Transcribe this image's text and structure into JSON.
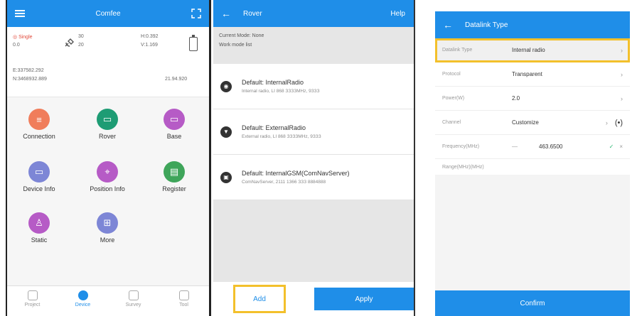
{
  "screen1": {
    "title": "Comfee",
    "status": {
      "solution": "Single",
      "line2": "0.0",
      "sat_a": "30",
      "sat_b": "20",
      "hrms": "H:0.392",
      "vrms": "V:1.169",
      "east": "E:337582.292",
      "north": "N:3468932.889",
      "alt": "21.94.920"
    },
    "tiles": [
      {
        "label": "Connection",
        "color": "#f07d5b",
        "icon": "connection-icon"
      },
      {
        "label": "Rover",
        "color": "#1e9c74",
        "icon": "rover-icon"
      },
      {
        "label": "Base",
        "color": "#b65bc6",
        "icon": "base-icon"
      },
      {
        "label": "Device Info",
        "color": "#7d86d6",
        "icon": "device-info-icon"
      },
      {
        "label": "Position Info",
        "color": "#b65bc6",
        "icon": "position-info-icon"
      },
      {
        "label": "Register",
        "color": "#3fa55a",
        "icon": "register-icon"
      },
      {
        "label": "Static",
        "color": "#b65bc6",
        "icon": "static-icon"
      },
      {
        "label": "More",
        "color": "#7d86d6",
        "icon": "more-icon"
      }
    ],
    "tabs": [
      {
        "label": "Project",
        "active": false
      },
      {
        "label": "Device",
        "active": true
      },
      {
        "label": "Survey",
        "active": false
      },
      {
        "label": "Tool",
        "active": false
      }
    ]
  },
  "screen2": {
    "title": "Rover",
    "help": "Help",
    "current_mode": "Current Mode: None",
    "work_mode": "Work mode list",
    "items": [
      {
        "title": "Default: InternalRadio",
        "sub": "Internal radio, LI 868 ЗЗЗЗМНz, 9ЗЗЗ",
        "icon": "radio-icon"
      },
      {
        "title": "Default: ExternalRadio",
        "sub": "External radio, LI 868 ЗЗЗЗМНz, 9ЗЗЗ",
        "icon": "external-radio-icon"
      },
      {
        "title": "Default: InternalGSM(ComNavServer)",
        "sub": "ComNavServer, 2111 1366 ЗЗЗ 8884888",
        "icon": "gsm-icon"
      }
    ],
    "add": "Add",
    "apply": "Apply"
  },
  "screen3": {
    "title": "Datalink Type",
    "rows": [
      {
        "label": "Datalink Type",
        "value": "Internal radio",
        "highlight": true
      },
      {
        "label": "Protocol",
        "value": "Transparent"
      },
      {
        "label": "Power(W)",
        "value": "2.0"
      },
      {
        "label": "Channel",
        "value": "Customize"
      },
      {
        "label": "Frequency(MHz)",
        "value": "463.6500"
      },
      {
        "label": "Range(MHz)(MHz)",
        "value": ""
      }
    ],
    "confirm": "Confirm"
  },
  "colors": {
    "accent": "#1f8ee8",
    "highlight": "#f3c02b"
  }
}
